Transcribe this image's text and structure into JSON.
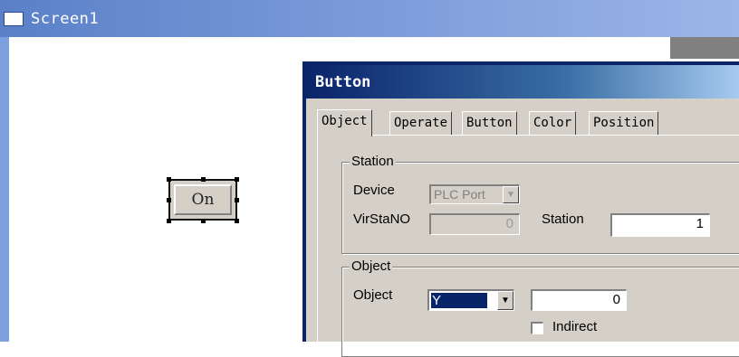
{
  "screen": {
    "title": "Screen1",
    "icon": "window-icon"
  },
  "canvas_button": {
    "label": "On"
  },
  "dialog": {
    "title": "Button",
    "tabs": [
      {
        "label": "Object"
      },
      {
        "label": "Operate"
      },
      {
        "label": "Button"
      },
      {
        "label": "Color"
      },
      {
        "label": "Position"
      }
    ],
    "station_group": {
      "legend": "Station",
      "device_label": "Device",
      "device_value": "PLC Port",
      "virstano_label": "VirStaNO",
      "virstano_value": "0",
      "station_label": "Station",
      "station_value": "1"
    },
    "object_group": {
      "legend": "Object",
      "object_label": "Object",
      "object_value": "Y",
      "address_value": "0",
      "indirect_label": "Indirect"
    }
  },
  "colors": {
    "titlebar_gradient_start": "#5b80c8",
    "dialog_title_start": "#0a246a",
    "dialog_face": "#d4d0c8",
    "selection": "#0a246a"
  }
}
